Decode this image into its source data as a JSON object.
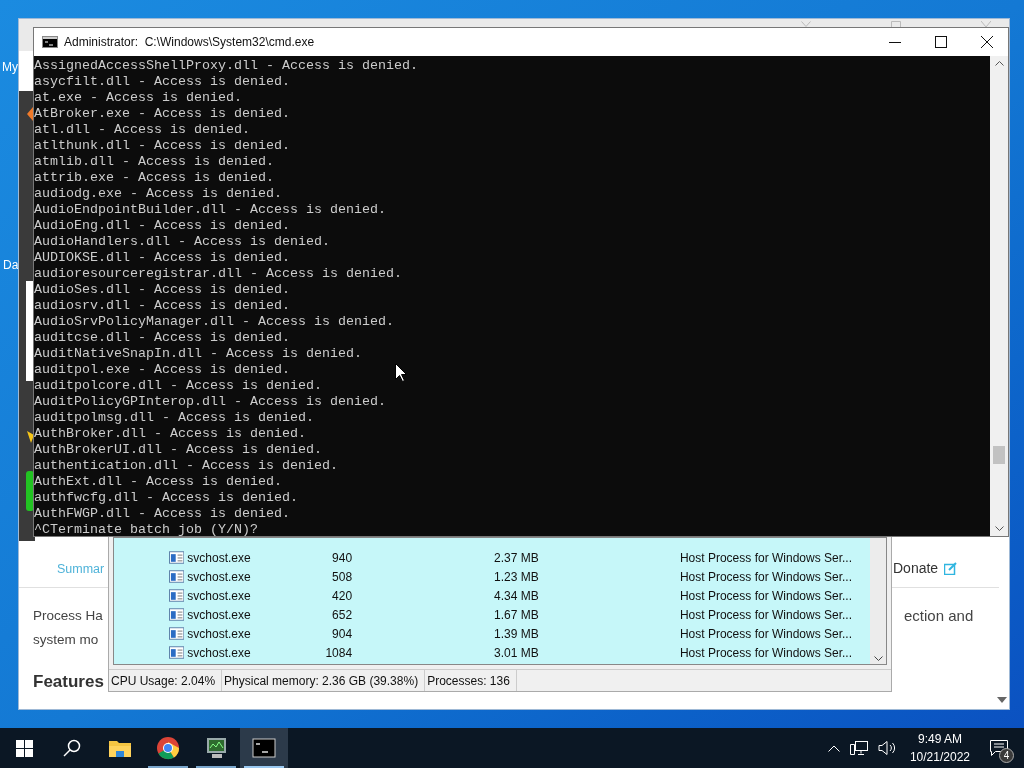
{
  "desktop_icons": [
    {
      "label": "My"
    },
    {
      "label": "Da"
    }
  ],
  "browser": {
    "nav_links": [
      {
        "label": "Summar"
      },
      {
        "label": "Donate"
      }
    ],
    "paragraph_left": [
      "Process Ha",
      "system mo"
    ],
    "paragraph_right": "ection and",
    "heading": "Features"
  },
  "process_window": {
    "rows": [
      {
        "name": "svchost.exe",
        "pid": "940",
        "memory": "2.37 MB",
        "description": "Host Process for Windows Ser..."
      },
      {
        "name": "svchost.exe",
        "pid": "508",
        "memory": "1.23 MB",
        "description": "Host Process for Windows Ser..."
      },
      {
        "name": "svchost.exe",
        "pid": "420",
        "memory": "4.34 MB",
        "description": "Host Process for Windows Ser..."
      },
      {
        "name": "svchost.exe",
        "pid": "652",
        "memory": "1.67 MB",
        "description": "Host Process for Windows Ser..."
      },
      {
        "name": "svchost.exe",
        "pid": "904",
        "memory": "1.39 MB",
        "description": "Host Process for Windows Ser..."
      },
      {
        "name": "svchost.exe",
        "pid": "1084",
        "memory": "3.01 MB",
        "description": "Host Process for Windows Ser..."
      }
    ],
    "status_bar": [
      "CPU Usage: 2.04%",
      "Physical memory: 2.36 GB (39.38%)",
      "Processes: 136"
    ]
  },
  "cmd": {
    "title": "Administrator:  C:\\Windows\\System32\\cmd.exe",
    "lines": [
      "AssignedAccessShellProxy.dll - Access is denied.",
      "asycfilt.dll - Access is denied.",
      "at.exe - Access is denied.",
      "AtBroker.exe - Access is denied.",
      "atl.dll - Access is denied.",
      "atlthunk.dll - Access is denied.",
      "atmlib.dll - Access is denied.",
      "attrib.exe - Access is denied.",
      "audiodg.exe - Access is denied.",
      "AudioEndpointBuilder.dll - Access is denied.",
      "AudioEng.dll - Access is denied.",
      "AudioHandlers.dll - Access is denied.",
      "AUDIOKSE.dll - Access is denied.",
      "audioresourceregistrar.dll - Access is denied.",
      "AudioSes.dll - Access is denied.",
      "audiosrv.dll - Access is denied.",
      "AudioSrvPolicyManager.dll - Access is denied.",
      "auditcse.dll - Access is denied.",
      "AuditNativeSnapIn.dll - Access is denied.",
      "auditpol.exe - Access is denied.",
      "auditpolcore.dll - Access is denied.",
      "AuditPolicyGPInterop.dll - Access is denied.",
      "auditpolmsg.dll - Access is denied.",
      "AuthBroker.dll - Access is denied.",
      "AuthBrokerUI.dll - Access is denied.",
      "authentication.dll - Access is denied.",
      "AuthExt.dll - Access is denied.",
      "authfwcfg.dll - Access is denied.",
      "AuthFWGP.dll - Access is denied.",
      "^CTerminate batch job (Y/N)?"
    ]
  },
  "taskbar": {
    "apps": [
      {
        "kind": "explorer",
        "running": false,
        "selected": false
      },
      {
        "kind": "chrome",
        "running": true,
        "selected": false
      },
      {
        "kind": "monitor",
        "running": true,
        "selected": false
      },
      {
        "kind": "terminal",
        "running": true,
        "selected": true
      }
    ],
    "time": "9:49 AM",
    "date": "10/21/2022",
    "notification_count": "4"
  }
}
